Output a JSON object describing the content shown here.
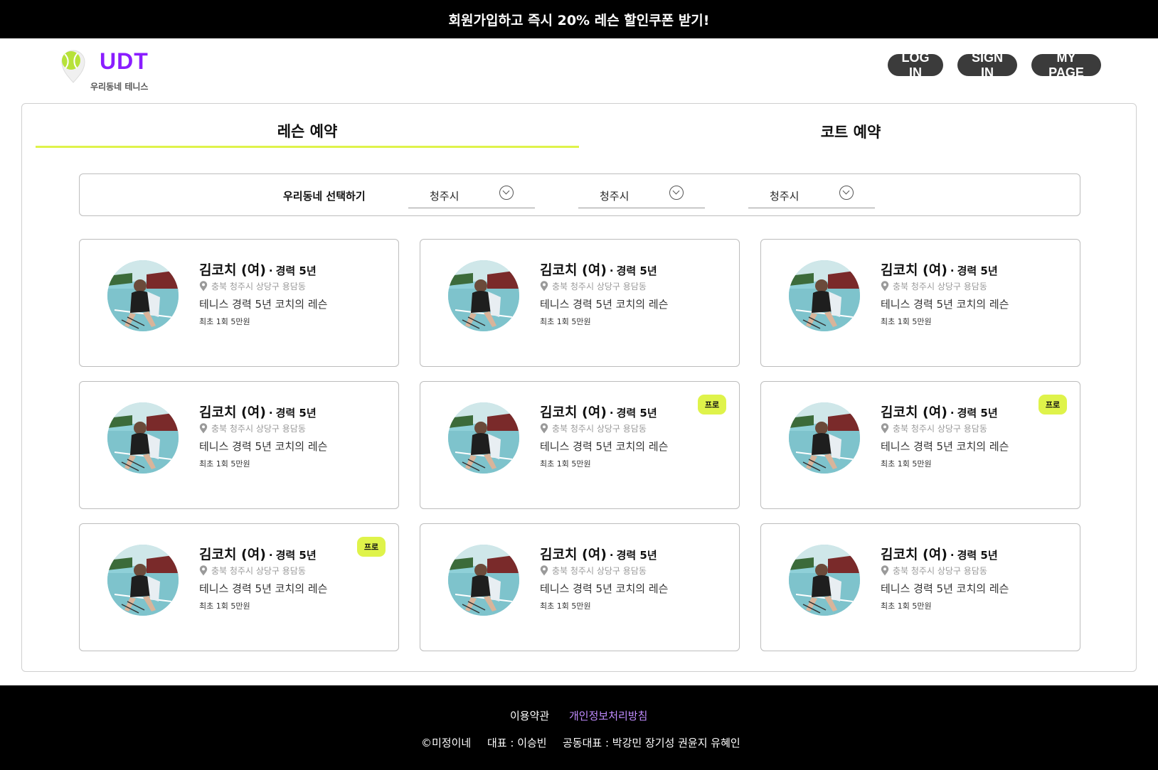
{
  "promo_banner": "회원가입하고 즉시 20% 레슨 할인쿠폰 받기!",
  "logo": {
    "title": "UDT",
    "subtitle": "우리동네 테니스",
    "icon": "tennis-ball-pin-icon"
  },
  "nav": {
    "login": "LOG IN",
    "signin": "SIGN IN",
    "mypage": "MY PAGE"
  },
  "tabs": [
    {
      "label": "레슨 예약",
      "active": true
    },
    {
      "label": "코트 예약",
      "active": false
    }
  ],
  "filter": {
    "label": "우리동네 선택하기",
    "selects": [
      {
        "value": "청주시"
      },
      {
        "value": "청주시"
      },
      {
        "value": "청주시"
      }
    ]
  },
  "cards": [
    {
      "name": "김코치 (여)",
      "sep": "·",
      "career": "경력 5년",
      "location": "충북 청주시 상당구 용담동",
      "desc": "테니스 경력 5년 코치의 레슨",
      "price": "최초 1회 5만원",
      "badge": ""
    },
    {
      "name": "김코치 (여)",
      "sep": "·",
      "career": "경력 5년",
      "location": "충북 청주시 상당구 용담동",
      "desc": "테니스 경력 5년 코치의 레슨",
      "price": "최초 1회 5만원",
      "badge": ""
    },
    {
      "name": "김코치 (여)",
      "sep": "·",
      "career": "경력 5년",
      "location": "충북 청주시 상당구 용담동",
      "desc": "테니스 경력 5년 코치의 레슨",
      "price": "최초 1회 5만원",
      "badge": ""
    },
    {
      "name": "김코치 (여)",
      "sep": "·",
      "career": "경력 5년",
      "location": "충북 청주시 상당구 용담동",
      "desc": "테니스 경력 5년 코치의 레슨",
      "price": "최초 1회 5만원",
      "badge": ""
    },
    {
      "name": "김코치 (여)",
      "sep": "·",
      "career": "경력 5년",
      "location": "충북 청주시 상당구 용담동",
      "desc": "테니스 경력 5년 코치의 레슨",
      "price": "최초 1회 5만원",
      "badge": "프로"
    },
    {
      "name": "김코치 (여)",
      "sep": "·",
      "career": "경력 5년",
      "location": "충북 청주시 상당구 용담동",
      "desc": "테니스 경력 5년 코치의 레슨",
      "price": "최초 1회 5만원",
      "badge": "프로"
    },
    {
      "name": "김코치 (여)",
      "sep": "·",
      "career": "경력 5년",
      "location": "충북 청주시 상당구 용담동",
      "desc": "테니스 경력 5년 코치의 레슨",
      "price": "최초 1회 5만원",
      "badge": "프로"
    },
    {
      "name": "김코치 (여)",
      "sep": "·",
      "career": "경력 5년",
      "location": "충북 청주시 상당구 용담동",
      "desc": "테니스 경력 5년 코치의 레슨",
      "price": "최초 1회 5만원",
      "badge": ""
    },
    {
      "name": "김코치 (여)",
      "sep": "·",
      "career": "경력 5년",
      "location": "충북 청주시 상당구 용담동",
      "desc": "테니스 경력 5년 코치의 레슨",
      "price": "최초 1회 5만원",
      "badge": ""
    }
  ],
  "footer": {
    "terms": "이용약관",
    "privacy": "개인정보처리방침",
    "copyright": "©미정이네",
    "ceo": "대표 : 이승빈",
    "co_ceo": "공동대표 : 박강민 장기성 권윤지 유혜인"
  },
  "colors": {
    "accent": "#dff34a",
    "brand": "#8a1dff",
    "privacy_link": "#c18cff",
    "nav_button": "#3b3b3b"
  }
}
